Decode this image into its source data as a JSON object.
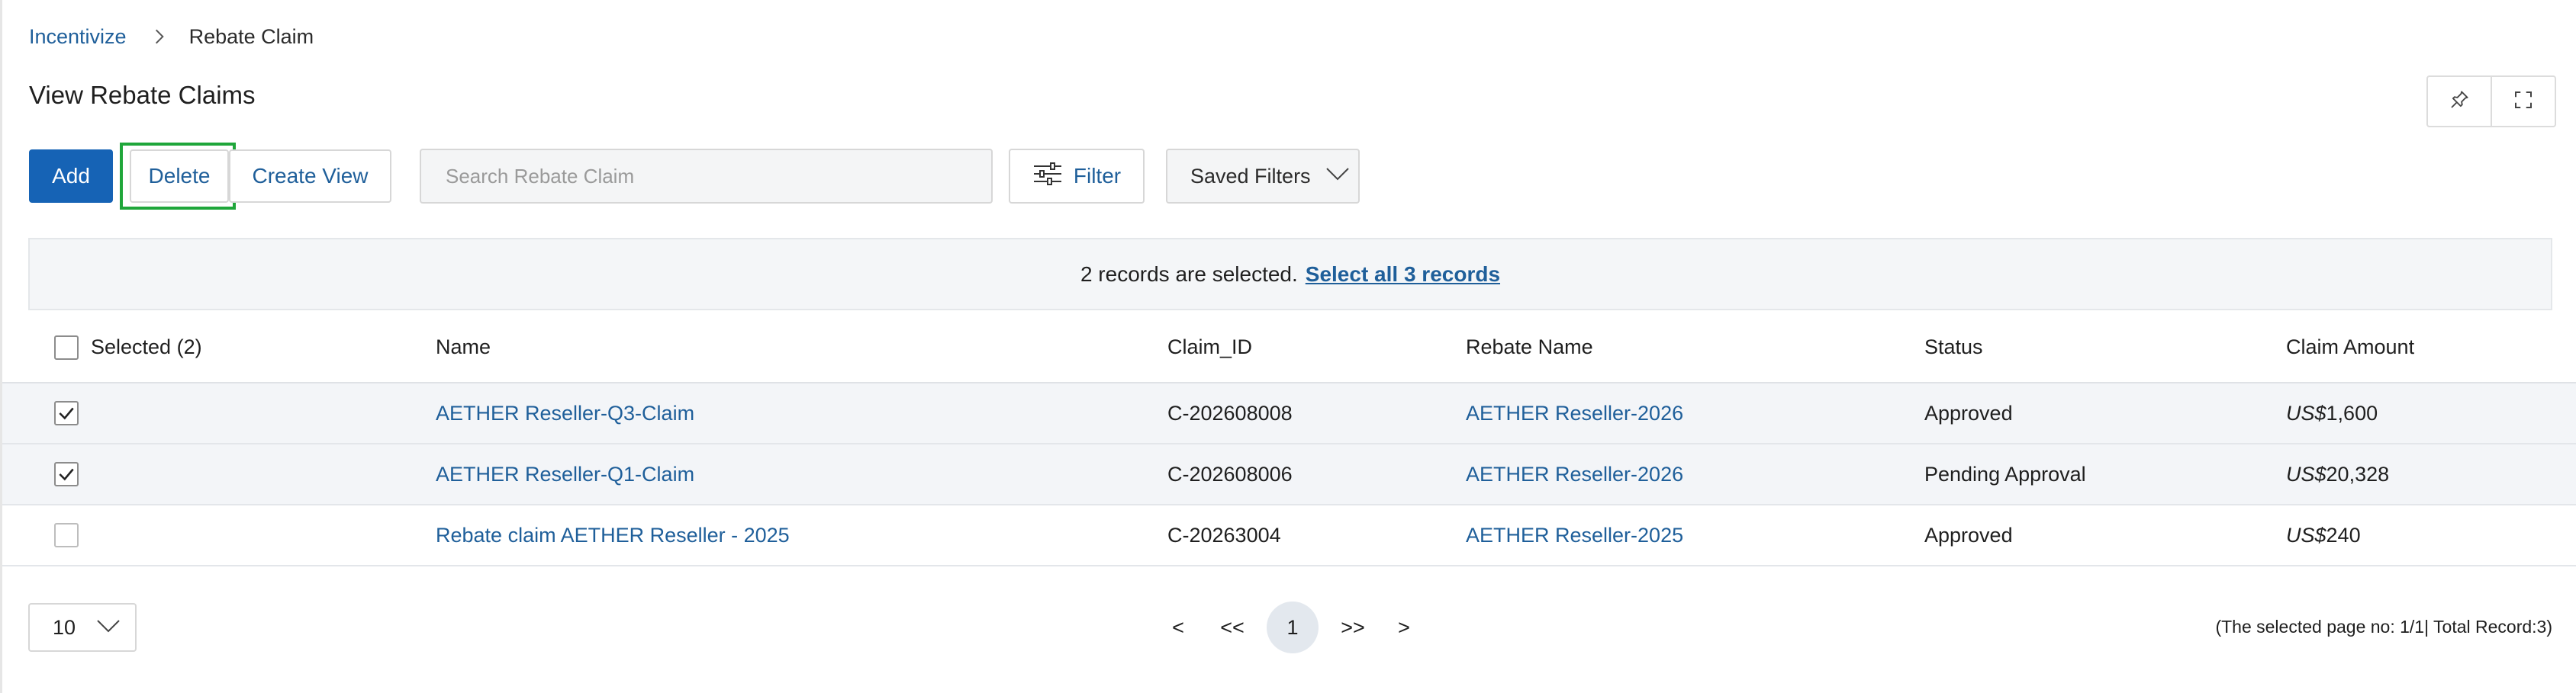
{
  "breadcrumb": {
    "root": "Incentivize",
    "current": "Rebate Claim"
  },
  "page": {
    "title": "View Rebate Claims"
  },
  "toolbar": {
    "add_label": "Add",
    "delete_label": "Delete",
    "create_view_label": "Create View",
    "search_placeholder": "Search Rebate Claim",
    "filter_label": "Filter",
    "saved_filters_label": "Saved Filters"
  },
  "icons": {
    "pin": "pin-icon",
    "expand": "expand-icon",
    "filter": "sliders-icon",
    "dropdown": "chevron-down-icon",
    "breadcrumb_separator": "chevron-right-icon",
    "check": "check-icon"
  },
  "selection_banner": {
    "message": "2 records are selected.",
    "select_all_label": "Select all 3 records"
  },
  "table": {
    "columns": {
      "selected": "Selected (2)",
      "name": "Name",
      "claim_id": "Claim_ID",
      "rebate_name": "Rebate Name",
      "status": "Status",
      "claim_amount": "Claim Amount"
    },
    "rows": [
      {
        "checked": true,
        "name": "AETHER Reseller-Q3-Claim",
        "claim_id": "C-202608008",
        "rebate_name": "AETHER Reseller-2026",
        "status": "Approved",
        "currency": "US$",
        "amount": "1,600"
      },
      {
        "checked": true,
        "name": "AETHER Reseller-Q1-Claim",
        "claim_id": "C-202608006",
        "rebate_name": "AETHER Reseller-2026",
        "status": "Pending Approval",
        "currency": "US$",
        "amount": "20,328"
      },
      {
        "checked": false,
        "name": "Rebate claim AETHER Reseller - 2025",
        "claim_id": "C-20263004",
        "rebate_name": "AETHER Reseller-2025",
        "status": "Approved",
        "currency": "US$",
        "amount": "240"
      }
    ]
  },
  "pagination": {
    "page_size": "10",
    "prev": "<",
    "first": "<<",
    "current_page": "1",
    "last": ">>",
    "next": ">",
    "info": "(The selected page no: 1/1| Total Record:3)"
  },
  "colors": {
    "primary": "#1663b5",
    "link": "#1f5f9a",
    "highlight_outline": "#1fa63a",
    "selected_row_bg": "#f3f5f8"
  }
}
